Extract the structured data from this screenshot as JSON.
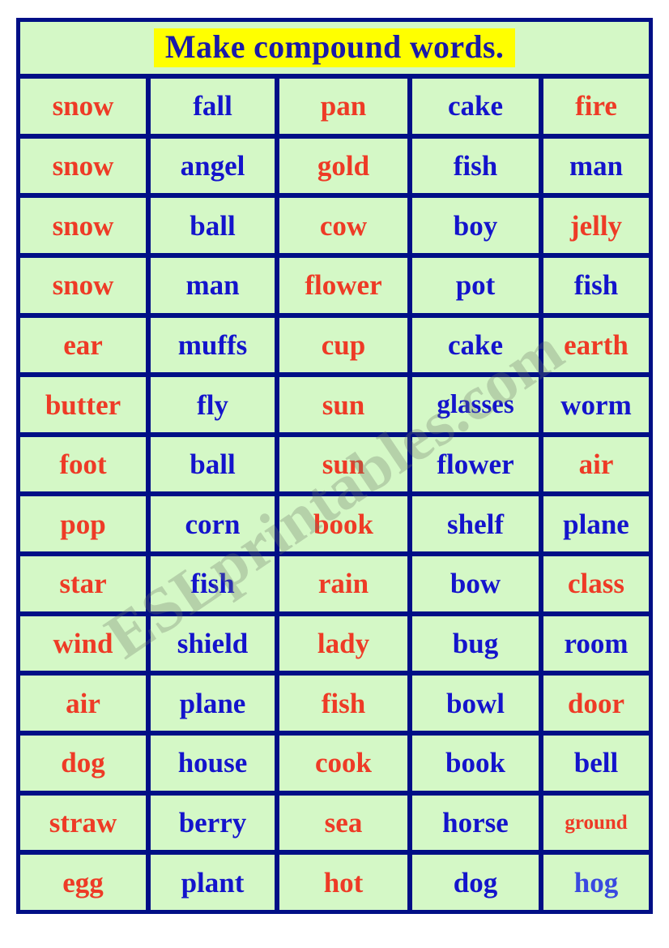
{
  "colors": {
    "frame": "#000f86",
    "cell_background": "#d4f8c6",
    "page_background": "#ffffff",
    "title_highlight": "#ffff00",
    "title_text": "#1a1aa8",
    "word_red": "#ee3b26",
    "word_blue": "#1414cc",
    "word_blue_light": "#3a49e0",
    "watermark": "#6c7868"
  },
  "title": {
    "text": "Make compound words."
  },
  "watermark": {
    "text": "ESLprintables.com"
  },
  "table": {
    "columns": 5,
    "rows": 14,
    "cells": [
      [
        {
          "word": "snow",
          "color": "red"
        },
        {
          "word": "fall",
          "color": "blue"
        },
        {
          "word": "pan",
          "color": "red"
        },
        {
          "word": "cake",
          "color": "blue"
        },
        {
          "word": "fire",
          "color": "red"
        }
      ],
      [
        {
          "word": "snow",
          "color": "red"
        },
        {
          "word": "angel",
          "color": "blue"
        },
        {
          "word": "gold",
          "color": "red"
        },
        {
          "word": "fish",
          "color": "blue"
        },
        {
          "word": "man",
          "color": "blue"
        }
      ],
      [
        {
          "word": "snow",
          "color": "red"
        },
        {
          "word": "ball",
          "color": "blue"
        },
        {
          "word": "cow",
          "color": "red"
        },
        {
          "word": "boy",
          "color": "blue"
        },
        {
          "word": "jelly",
          "color": "red"
        }
      ],
      [
        {
          "word": "snow",
          "color": "red"
        },
        {
          "word": "man",
          "color": "blue"
        },
        {
          "word": "flower",
          "color": "red"
        },
        {
          "word": "pot",
          "color": "blue"
        },
        {
          "word": "fish",
          "color": "blue"
        }
      ],
      [
        {
          "word": "ear",
          "color": "red"
        },
        {
          "word": "muffs",
          "color": "blue"
        },
        {
          "word": "cup",
          "color": "red"
        },
        {
          "word": "cake",
          "color": "blue"
        },
        {
          "word": "earth",
          "color": "red"
        }
      ],
      [
        {
          "word": "butter",
          "color": "red"
        },
        {
          "word": "fly",
          "color": "blue"
        },
        {
          "word": "sun",
          "color": "red"
        },
        {
          "word": "glasses",
          "color": "blue",
          "size": "fit"
        },
        {
          "word": "worm",
          "color": "blue"
        }
      ],
      [
        {
          "word": "foot",
          "color": "red"
        },
        {
          "word": "ball",
          "color": "blue"
        },
        {
          "word": "sun",
          "color": "red"
        },
        {
          "word": "flower",
          "color": "blue"
        },
        {
          "word": "air",
          "color": "red"
        }
      ],
      [
        {
          "word": "pop",
          "color": "red"
        },
        {
          "word": "corn",
          "color": "blue"
        },
        {
          "word": "book",
          "color": "red"
        },
        {
          "word": "shelf",
          "color": "blue"
        },
        {
          "word": "plane",
          "color": "blue"
        }
      ],
      [
        {
          "word": "star",
          "color": "red"
        },
        {
          "word": "fish",
          "color": "blue"
        },
        {
          "word": "rain",
          "color": "red"
        },
        {
          "word": "bow",
          "color": "blue"
        },
        {
          "word": "class",
          "color": "red"
        }
      ],
      [
        {
          "word": "wind",
          "color": "red"
        },
        {
          "word": "shield",
          "color": "blue"
        },
        {
          "word": "lady",
          "color": "red"
        },
        {
          "word": "bug",
          "color": "blue"
        },
        {
          "word": "room",
          "color": "blue"
        }
      ],
      [
        {
          "word": "air",
          "color": "red"
        },
        {
          "word": "plane",
          "color": "blue"
        },
        {
          "word": "fish",
          "color": "red"
        },
        {
          "word": "bowl",
          "color": "blue"
        },
        {
          "word": "door",
          "color": "red"
        }
      ],
      [
        {
          "word": "dog",
          "color": "red"
        },
        {
          "word": "house",
          "color": "blue"
        },
        {
          "word": "cook",
          "color": "red"
        },
        {
          "word": "book",
          "color": "blue"
        },
        {
          "word": "bell",
          "color": "blue"
        }
      ],
      [
        {
          "word": "straw",
          "color": "red"
        },
        {
          "word": "berry",
          "color": "blue"
        },
        {
          "word": "sea",
          "color": "red"
        },
        {
          "word": "horse",
          "color": "blue"
        },
        {
          "word": "ground",
          "color": "red",
          "size": "small"
        }
      ],
      [
        {
          "word": "egg",
          "color": "red"
        },
        {
          "word": "plant",
          "color": "blue"
        },
        {
          "word": "hot",
          "color": "red"
        },
        {
          "word": "dog",
          "color": "blue"
        },
        {
          "word": "hog",
          "color": "blue2"
        }
      ]
    ]
  }
}
